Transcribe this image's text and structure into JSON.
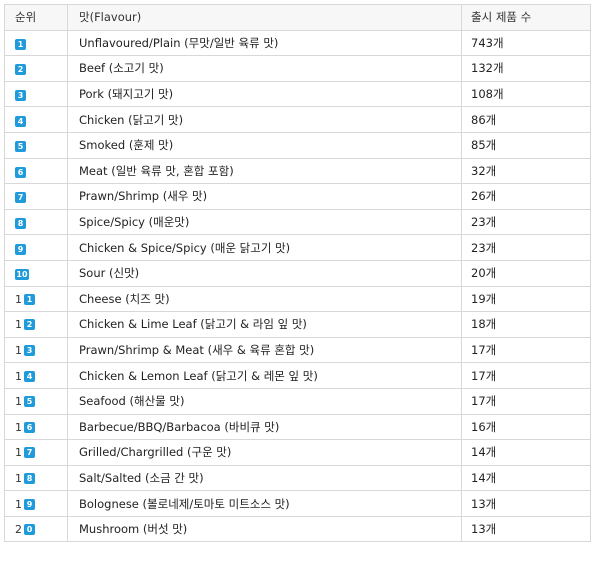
{
  "table": {
    "headers": [
      "순위",
      "맛(Flavour)",
      "출시 제품 수"
    ],
    "accent_color": "#1f9bdb",
    "rows": [
      {
        "rank": "1",
        "flavour": "Unflavoured/Plain (무맛/일반 육류 맛)",
        "count": "743개"
      },
      {
        "rank": "2",
        "flavour": "Beef (소고기 맛)",
        "count": "132개"
      },
      {
        "rank": "3",
        "flavour": "Pork (돼지고기 맛)",
        "count": "108개"
      },
      {
        "rank": "4",
        "flavour": "Chicken (닭고기 맛)",
        "count": "86개"
      },
      {
        "rank": "5",
        "flavour": "Smoked (훈제 맛)",
        "count": "85개"
      },
      {
        "rank": "6",
        "flavour": "Meat (일반 육류 맛, 혼합 포함)",
        "count": "32개"
      },
      {
        "rank": "7",
        "flavour": "Prawn/Shrimp (새우 맛)",
        "count": "26개"
      },
      {
        "rank": "8",
        "flavour": "Spice/Spicy (매운맛)",
        "count": "23개"
      },
      {
        "rank": "9",
        "flavour": "Chicken & Spice/Spicy (매운 닭고기 맛)",
        "count": "23개"
      },
      {
        "rank": "10",
        "flavour": "Sour (신맛)",
        "count": "20개"
      },
      {
        "rank": "11",
        "flavour": "Cheese (치즈 맛)",
        "count": "19개"
      },
      {
        "rank": "12",
        "flavour": "Chicken & Lime Leaf (닭고기 & 라임 잎 맛)",
        "count": "18개"
      },
      {
        "rank": "13",
        "flavour": "Prawn/Shrimp & Meat (새우 & 육류 혼합 맛)",
        "count": "17개"
      },
      {
        "rank": "14",
        "flavour": "Chicken & Lemon Leaf (닭고기 & 레몬 잎 맛)",
        "count": "17개"
      },
      {
        "rank": "15",
        "flavour": "Seafood (해산물 맛)",
        "count": "17개"
      },
      {
        "rank": "16",
        "flavour": "Barbecue/BBQ/Barbacoa (바비큐 맛)",
        "count": "16개"
      },
      {
        "rank": "17",
        "flavour": "Grilled/Chargrilled (구운 맛)",
        "count": "14개"
      },
      {
        "rank": "18",
        "flavour": "Salt/Salted (소금 간 맛)",
        "count": "14개"
      },
      {
        "rank": "19",
        "flavour": "Bolognese (볼로네제/토마토 미트소스 맛)",
        "count": "13개"
      },
      {
        "rank": "20",
        "flavour": "Mushroom (버섯 맛)",
        "count": "13개"
      }
    ]
  }
}
